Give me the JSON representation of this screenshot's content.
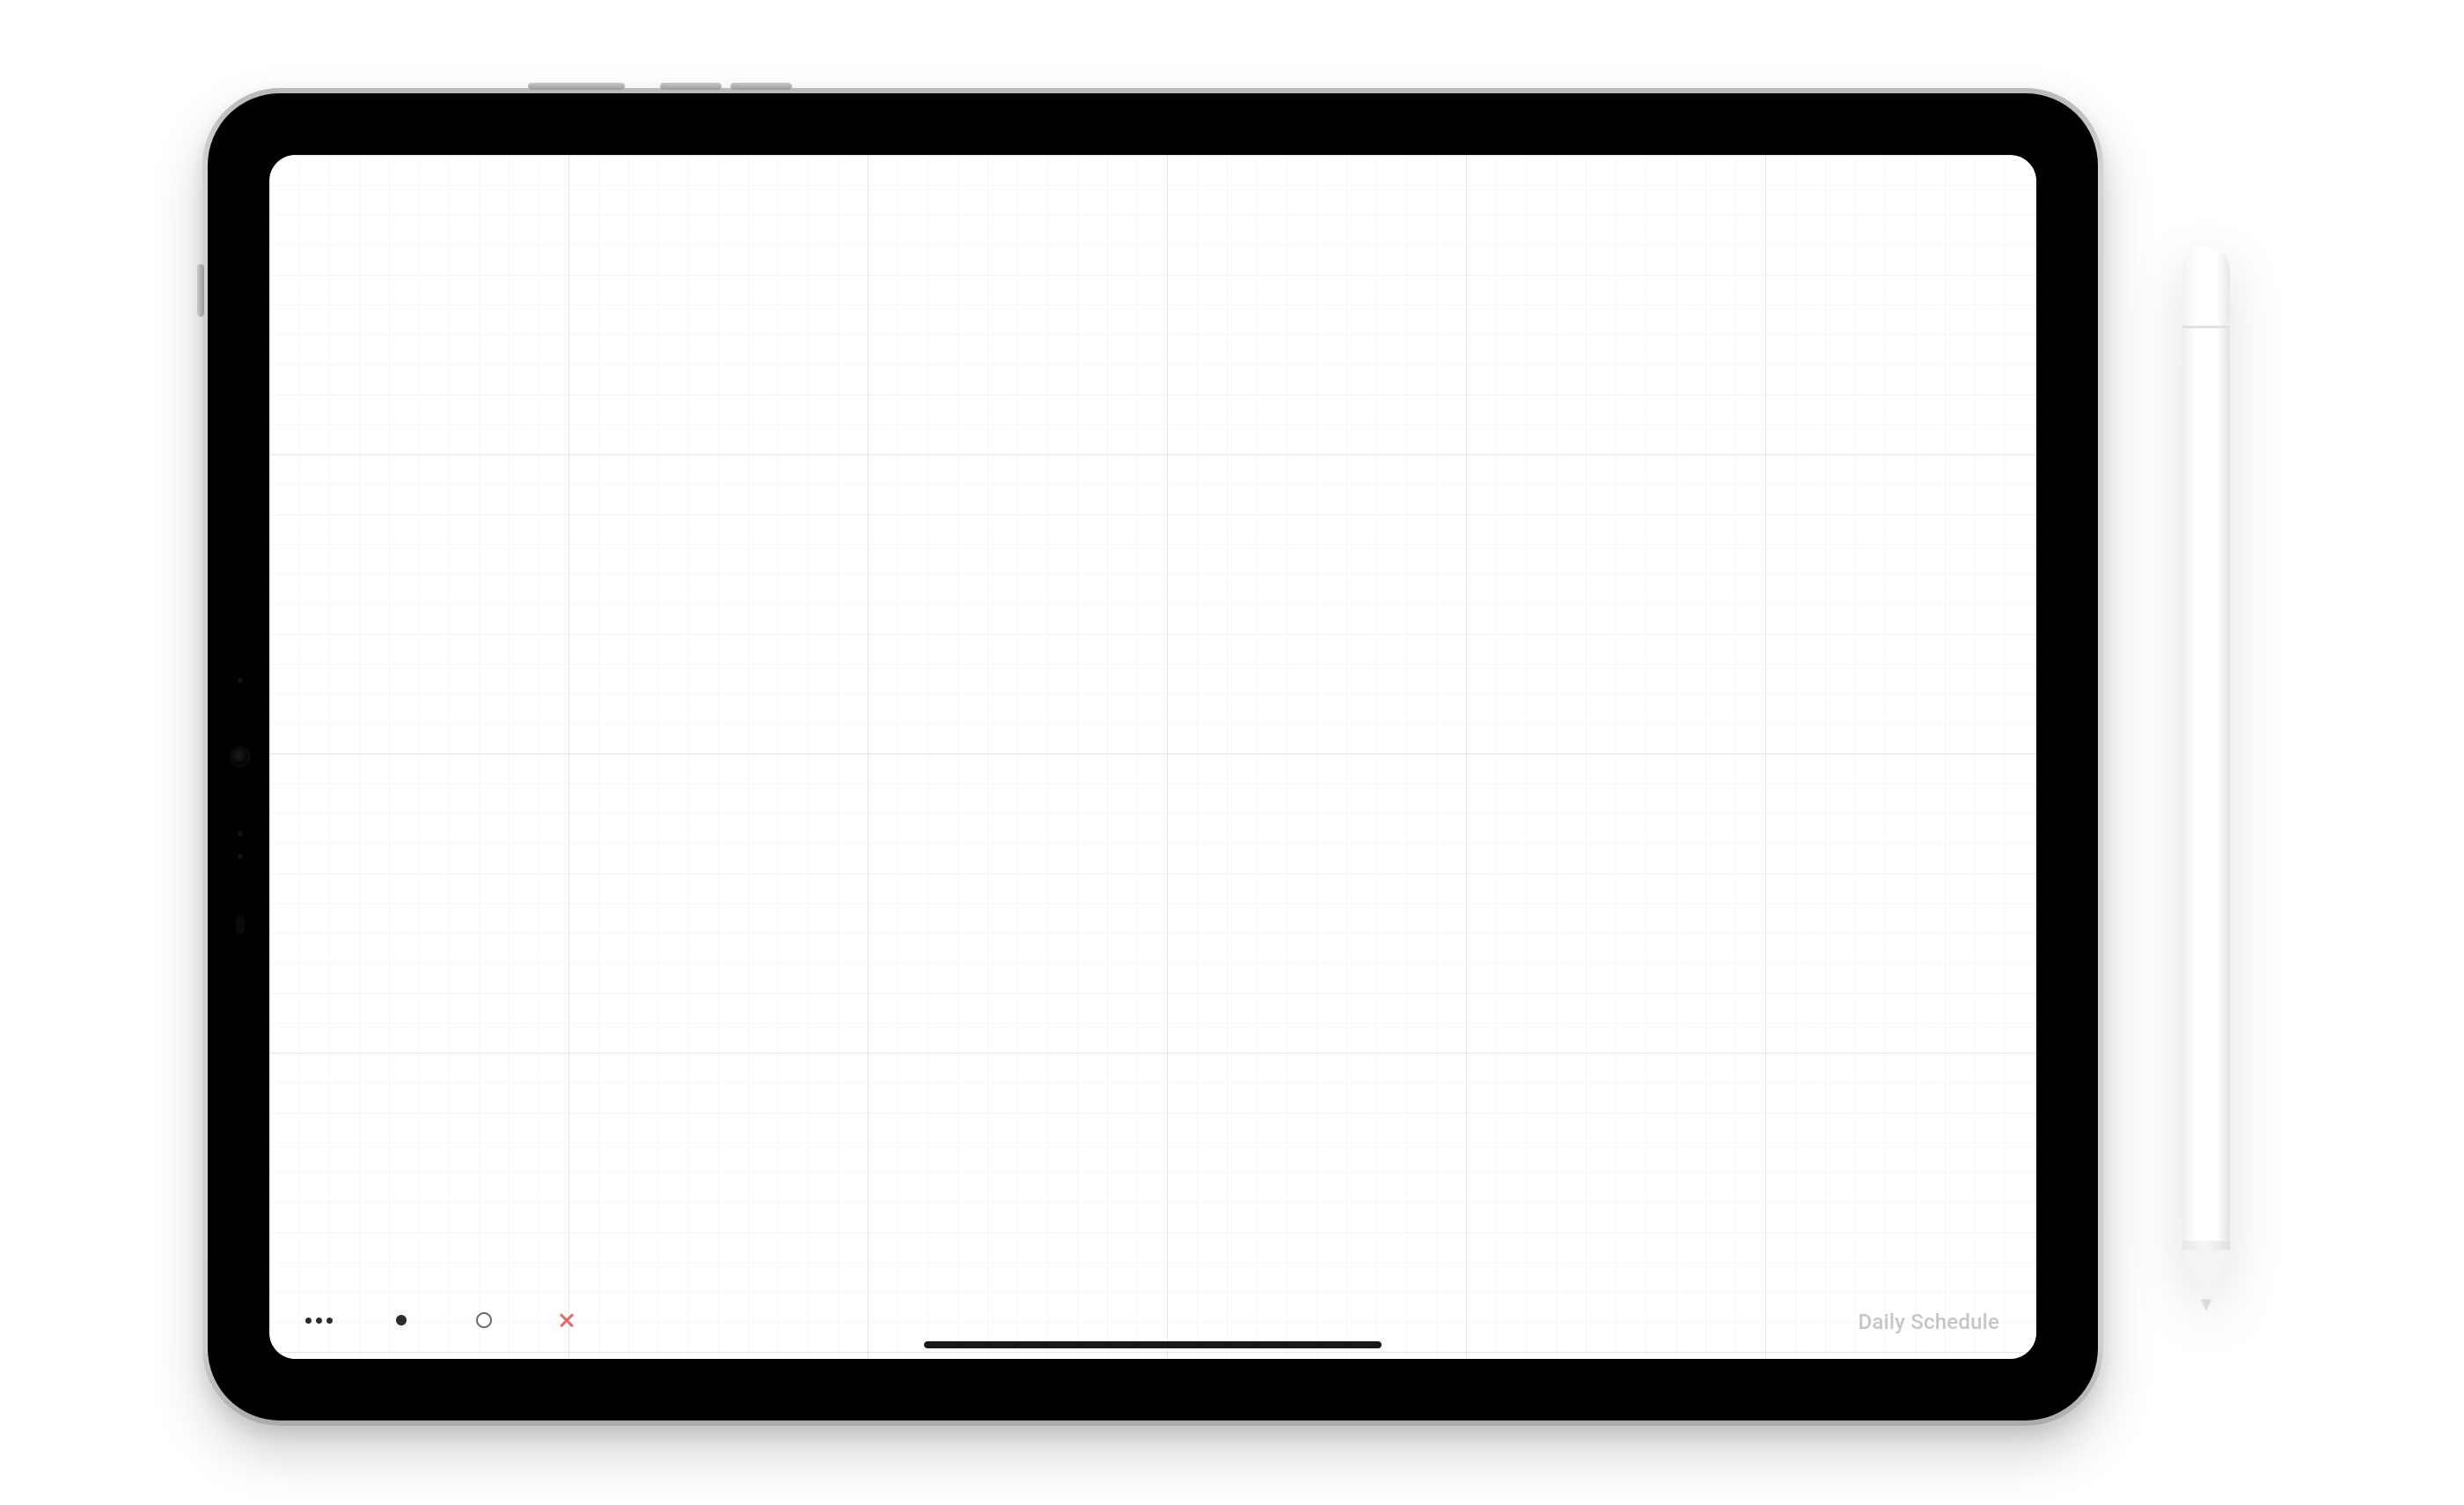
{
  "footer": {
    "label": "Daily Schedule"
  },
  "toolbar": {
    "items": [
      {
        "name": "more-icon"
      },
      {
        "name": "filled-dot-icon"
      },
      {
        "name": "outline-circle-icon"
      },
      {
        "name": "close-icon"
      }
    ]
  },
  "grid": {
    "minor_spacing_px": 34,
    "major_every": 10
  },
  "colors": {
    "grid_minor": "rgba(0,0,0,0.028)",
    "grid_major": "rgba(0,0,0,0.07)",
    "footer_text": "#c6c6c8",
    "close_icon": "#e06a6a"
  }
}
